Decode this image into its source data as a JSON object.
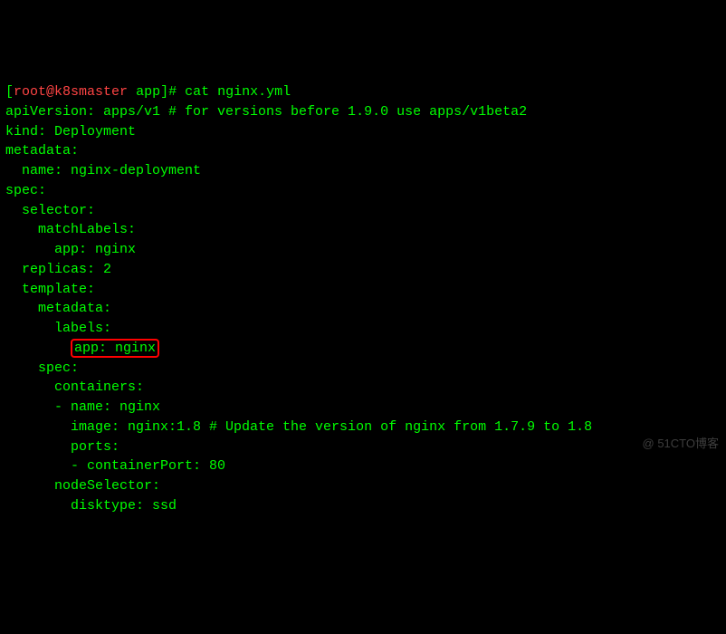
{
  "prompt": {
    "open_bracket": "[",
    "user_host": "root@k8smaster",
    "space1": " ",
    "path": "app",
    "close_bracket": "]",
    "hash": "# ",
    "command": "cat nginx.yml"
  },
  "yaml": {
    "l1": "apiVersion: apps/v1 # for versions before 1.9.0 use apps/v1beta2",
    "l2": "kind: Deployment",
    "l3": "metadata:",
    "l4": "  name: nginx-deployment",
    "l5": "spec:",
    "l6": "  selector:",
    "l7": "    matchLabels:",
    "l8": "      app: nginx",
    "l9": "  replicas: 2",
    "l10": "  template:",
    "l11": "    metadata:",
    "l12": "      labels:",
    "l13_prefix": "        ",
    "l13_highlight": "app: nginx",
    "l14": "    spec:",
    "l15": "      containers:",
    "l16": "      - name: nginx",
    "l17": "        image: nginx:1.8 # Update the version of nginx from 1.7.9 to 1.8",
    "l18": "        ports:",
    "l19": "        - containerPort: 80",
    "l20": "      nodeSelector:",
    "l21": "        disktype: ssd"
  },
  "watermark": "@ 51CTO博客"
}
